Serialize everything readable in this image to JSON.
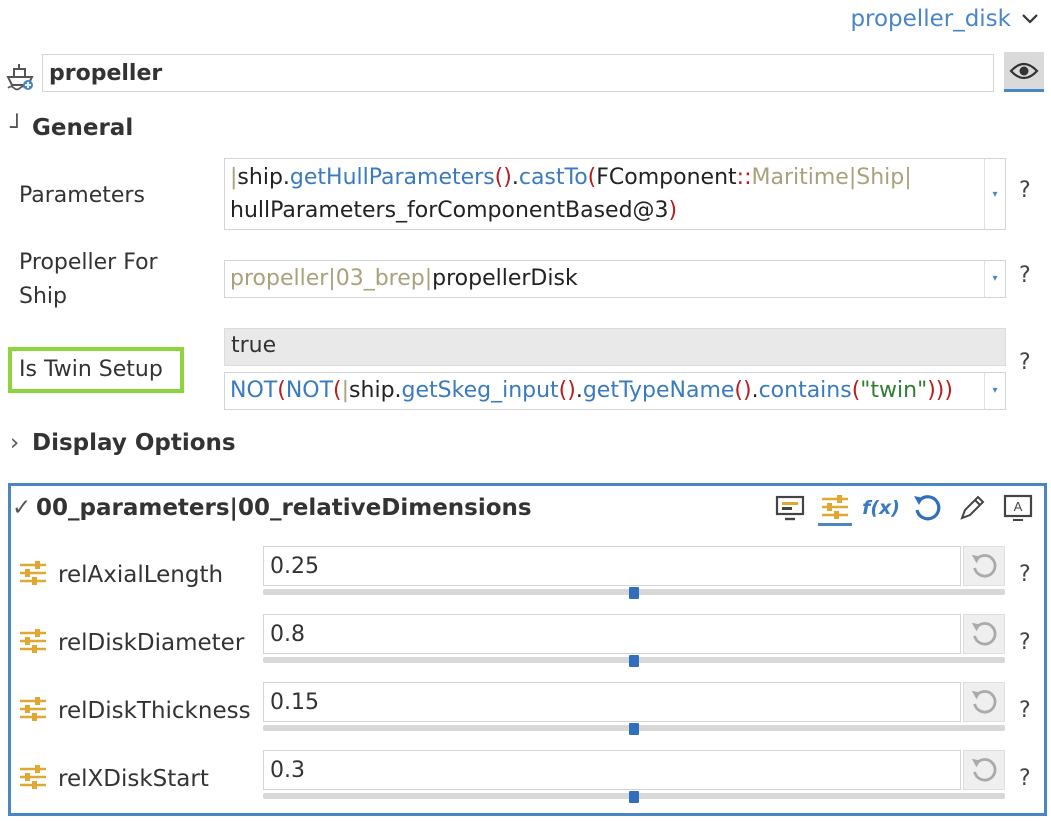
{
  "top_dropdown": {
    "label": "propeller_disk"
  },
  "component": {
    "name": "propeller"
  },
  "sections": {
    "general": "General",
    "display_options": "Display Options",
    "param_group": "00_parameters|00_relativeDimensions"
  },
  "general": {
    "parameters": {
      "label": "Parameters",
      "pipe_start": "|",
      "ship": "ship",
      "dot": ".",
      "fn1": "getHullParameters",
      "parens": "()",
      "fn2": "castTo",
      "open": "(",
      "fcomp": "FComponent",
      "colons": "::",
      "maritime": "Maritime",
      "pipe": "|",
      "shipword": "Ship",
      "line2": "hullParameters_forComponentBased@3",
      "close": ")"
    },
    "propeller_for_ship": {
      "label": "Propeller For Ship",
      "part1": "propeller|03_brep|",
      "part2": "propellerDisk"
    },
    "is_twin_setup": {
      "label": "Is Twin Setup",
      "value": "true",
      "expr_not": "NOT",
      "open": "(",
      "pipe": "|",
      "ship": "ship",
      "dot": ".",
      "fn1": "getSkeg_input",
      "parens": "()",
      "fn2": "getTypeName",
      "fn3": "contains",
      "str": "\"twin\"",
      "close3": ")))"
    },
    "help": "?"
  },
  "params": [
    {
      "name": "relAxialLength",
      "value": "0.25",
      "slider": 0.5
    },
    {
      "name": "relDiskDiameter",
      "value": "0.8",
      "slider": 0.5
    },
    {
      "name": "relDiskThickness",
      "value": "0.15",
      "slider": 0.5
    },
    {
      "name": "relXDiskStart",
      "value": "0.3",
      "slider": 0.5
    }
  ],
  "toolbar": {
    "fx_label": "f(x)"
  },
  "colors": {
    "accent": "#4a86c5",
    "highlight": "#8ed43c",
    "icon_gold": "#e0a832"
  }
}
